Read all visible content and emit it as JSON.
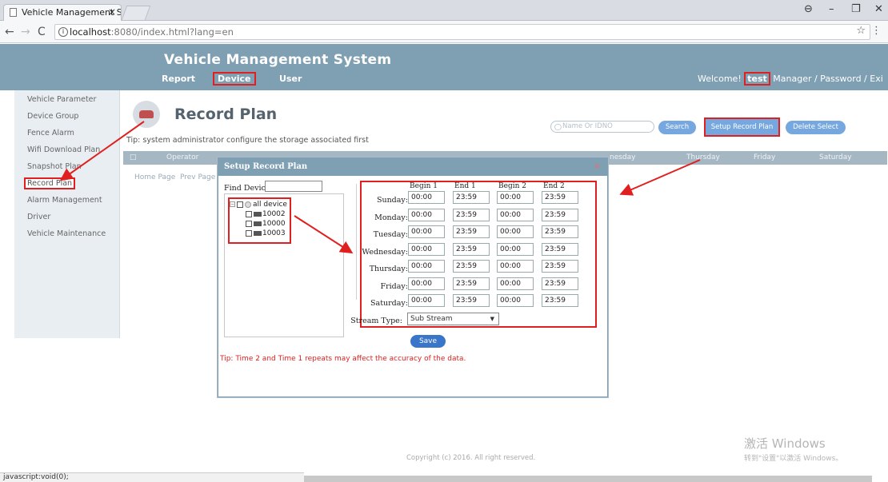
{
  "browser": {
    "tab_title": "Vehicle Management S",
    "tab_close": "×",
    "url_host": "localhost",
    "url_path": ":8080/index.html?lang=en",
    "status_text": "javascript:void(0);"
  },
  "app": {
    "title": "Vehicle Management System",
    "nav": [
      "Report",
      "Device",
      "User"
    ],
    "welcome_prefix": "Welcome!",
    "user": "test",
    "welcome_suffix": "Manager / Password / Exi"
  },
  "sidebar": {
    "items": [
      "Vehicle Parameter",
      "Device Group",
      "Fence Alarm",
      "Wifi Download Plan",
      "Snapshot Plan",
      "Record Plan",
      "Alarm Management",
      "Driver",
      "Vehicle Maintenance"
    ],
    "active": "Record Plan"
  },
  "main": {
    "title": "Record Plan",
    "tip": "Tip: system administrator configure the storage associated first",
    "search_placeholder": "Name Or IDNO",
    "search_button": "Search",
    "setup_button": "Setup Record Plan",
    "delete_button": "Delete Select",
    "table_columns": [
      "Operator",
      "nesday",
      "Thursday",
      "Friday",
      "Saturday"
    ],
    "pager": [
      "Home Page",
      "Prev Page"
    ],
    "copyright": "Copyright (c) 2016. All right reserved."
  },
  "modal": {
    "title": "Setup Record Plan",
    "close": "×",
    "find_label": "Find Device:",
    "tree": {
      "root": "all device",
      "devices": [
        "10002",
        "10000",
        "10003"
      ]
    },
    "columns": [
      "Begin 1",
      "End 1",
      "Begin 2",
      "End 2"
    ],
    "days": [
      {
        "day": "Sunday:",
        "b1": "00:00",
        "e1": "23:59",
        "b2": "00:00",
        "e2": "23:59"
      },
      {
        "day": "Monday:",
        "b1": "00:00",
        "e1": "23:59",
        "b2": "00:00",
        "e2": "23:59"
      },
      {
        "day": "Tuesday:",
        "b1": "00:00",
        "e1": "23:59",
        "b2": "00:00",
        "e2": "23:59"
      },
      {
        "day": "Wednesday:",
        "b1": "00:00",
        "e1": "23:59",
        "b2": "00:00",
        "e2": "23:59"
      },
      {
        "day": "Thursday:",
        "b1": "00:00",
        "e1": "23:59",
        "b2": "00:00",
        "e2": "23:59"
      },
      {
        "day": "Friday:",
        "b1": "00:00",
        "e1": "23:59",
        "b2": "00:00",
        "e2": "23:59"
      },
      {
        "day": "Saturday:",
        "b1": "00:00",
        "e1": "23:59",
        "b2": "00:00",
        "e2": "23:59"
      }
    ],
    "stream_label": "Stream Type:",
    "stream_value": "Sub Stream",
    "save": "Save",
    "warning": "Tip: Time 2 and Time 1 repeats may affect the accuracy of the data."
  },
  "watermark": {
    "line1": "激活 Windows",
    "line2": "转到\"设置\"以激活 Windows。"
  },
  "colors": {
    "header": "#7f9fb3",
    "highlight": "#e02020",
    "button": "#77a7df"
  }
}
